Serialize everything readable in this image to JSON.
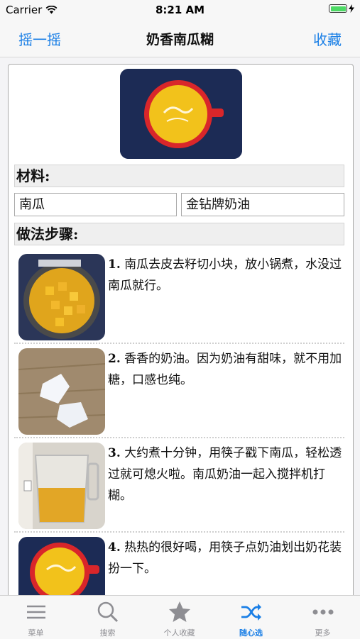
{
  "status": {
    "carrier": "Carrier",
    "time": "8:21 AM"
  },
  "nav": {
    "left": "摇一摇",
    "title": "奶香南瓜糊",
    "right": "收藏"
  },
  "recipe": {
    "ingredients_header": "材料:",
    "ingredients": [
      "南瓜",
      "金钻牌奶油"
    ],
    "steps_header": "做法步骤:",
    "steps": [
      {
        "num": "1.",
        "text": "南瓜去皮去籽切小块，放小锅煮，水没过南瓜就行。"
      },
      {
        "num": "2.",
        "text": "香香的奶油。因为奶油有甜味，就不用加糖，口感也纯。"
      },
      {
        "num": "3.",
        "text": "大约煮十分钟，用筷子戳下南瓜，轻松透过就可熄火啦。南瓜奶油一起入搅拌机打糊。"
      },
      {
        "num": "4.",
        "text": "热热的很好喝，用筷子点奶油划出奶花装扮一下。"
      }
    ]
  },
  "tabs": [
    {
      "label": "菜单",
      "icon": "menu-icon",
      "active": false
    },
    {
      "label": "搜索",
      "icon": "search-icon",
      "active": false
    },
    {
      "label": "个人收藏",
      "icon": "star-icon",
      "active": false
    },
    {
      "label": "随心选",
      "icon": "shuffle-icon",
      "active": true
    },
    {
      "label": "更多",
      "icon": "more-icon",
      "active": false
    }
  ],
  "colors": {
    "accent": "#1a7fe6",
    "tab_inactive": "#8e8e93"
  }
}
